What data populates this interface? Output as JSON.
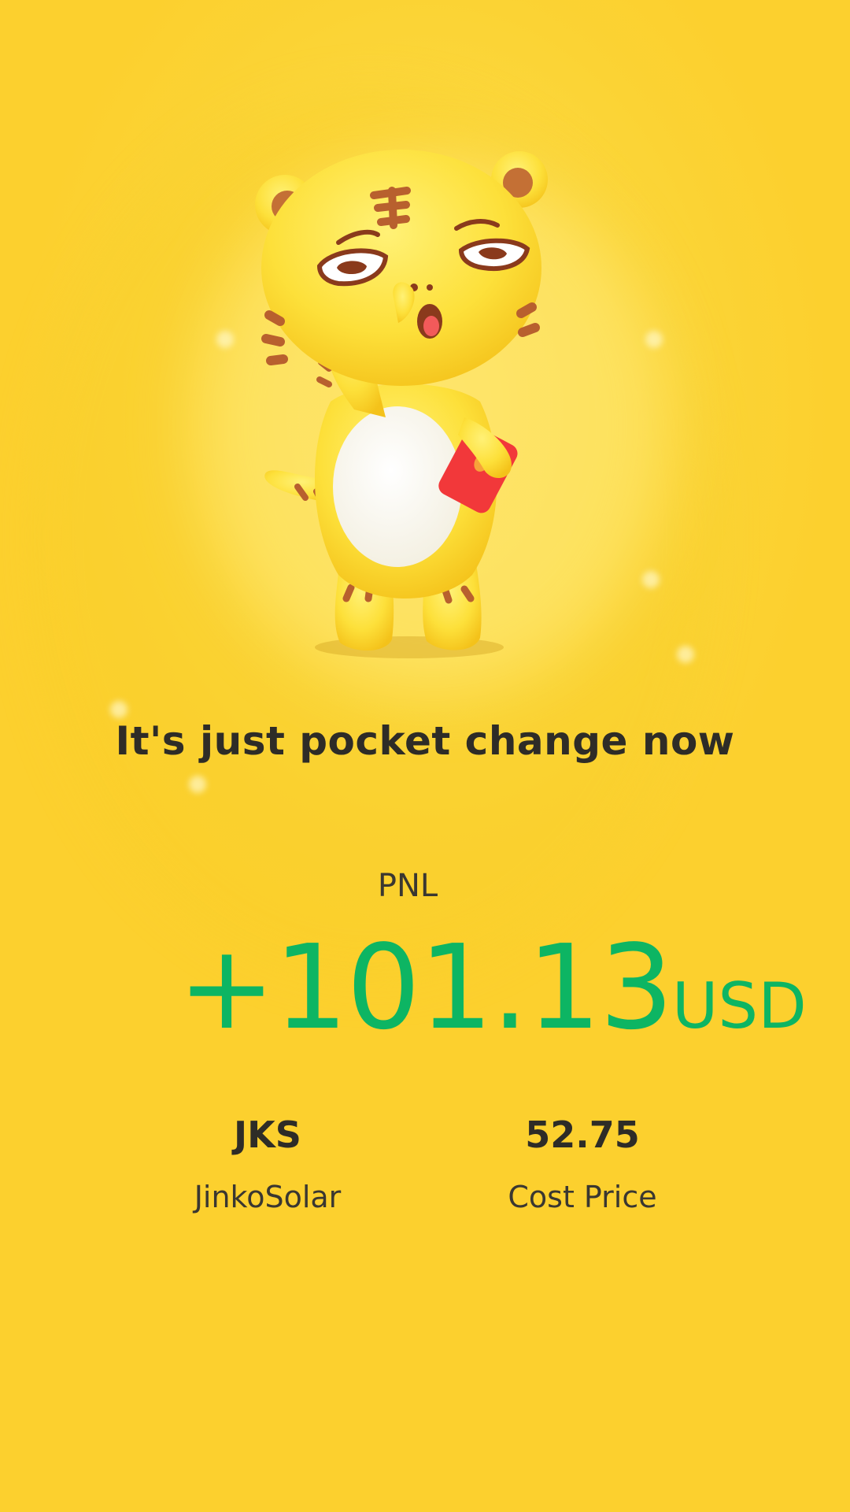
{
  "background": {
    "color": "#fcd433"
  },
  "mascot": {
    "icon": "tiger-mascot-icon",
    "holding": "red-envelope-icon"
  },
  "headline": "It's just pocket change now",
  "pnl": {
    "label": "PNL",
    "value": "+101.13",
    "unit": "USD",
    "color": "#0db563"
  },
  "stats": [
    {
      "value": "JKS",
      "caption": "JinkoSolar"
    },
    {
      "value": "52.75",
      "caption": "Cost Price"
    }
  ]
}
